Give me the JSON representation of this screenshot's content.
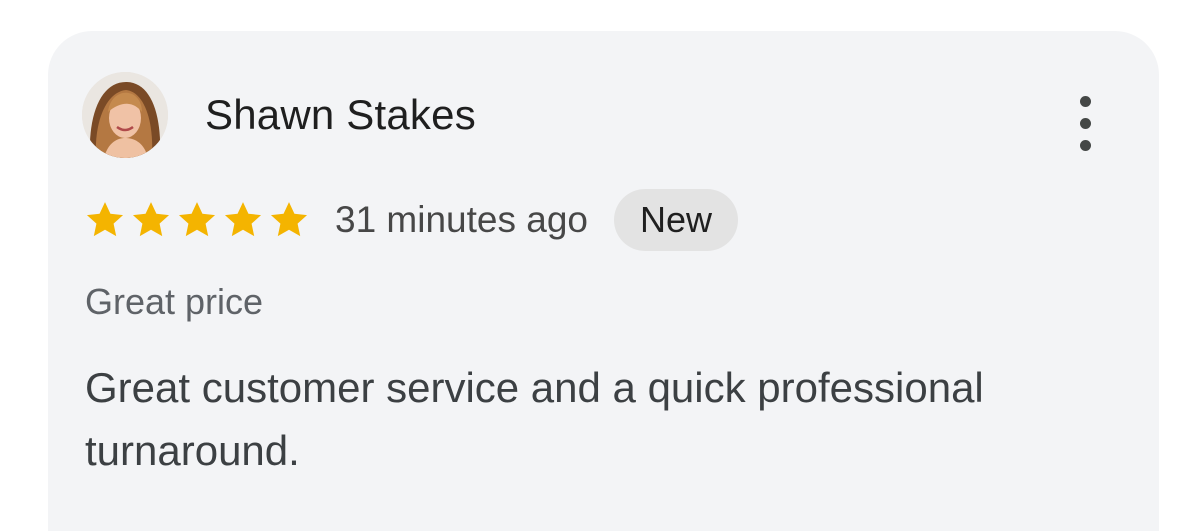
{
  "review": {
    "author": "Shawn Stakes",
    "rating": 5,
    "max_rating": 5,
    "time_ago": "31 minutes ago",
    "badge": "New",
    "tag": "Great price",
    "text": "Great customer service and a quick professional turnaround.",
    "avatar_icon": "user-photo",
    "menu_icon": "more-vert-icon",
    "star_icon": "star-icon"
  },
  "colors": {
    "card_bg": "#f3f4f6",
    "star": "#f4b400",
    "badge_bg": "#e3e3e3"
  }
}
